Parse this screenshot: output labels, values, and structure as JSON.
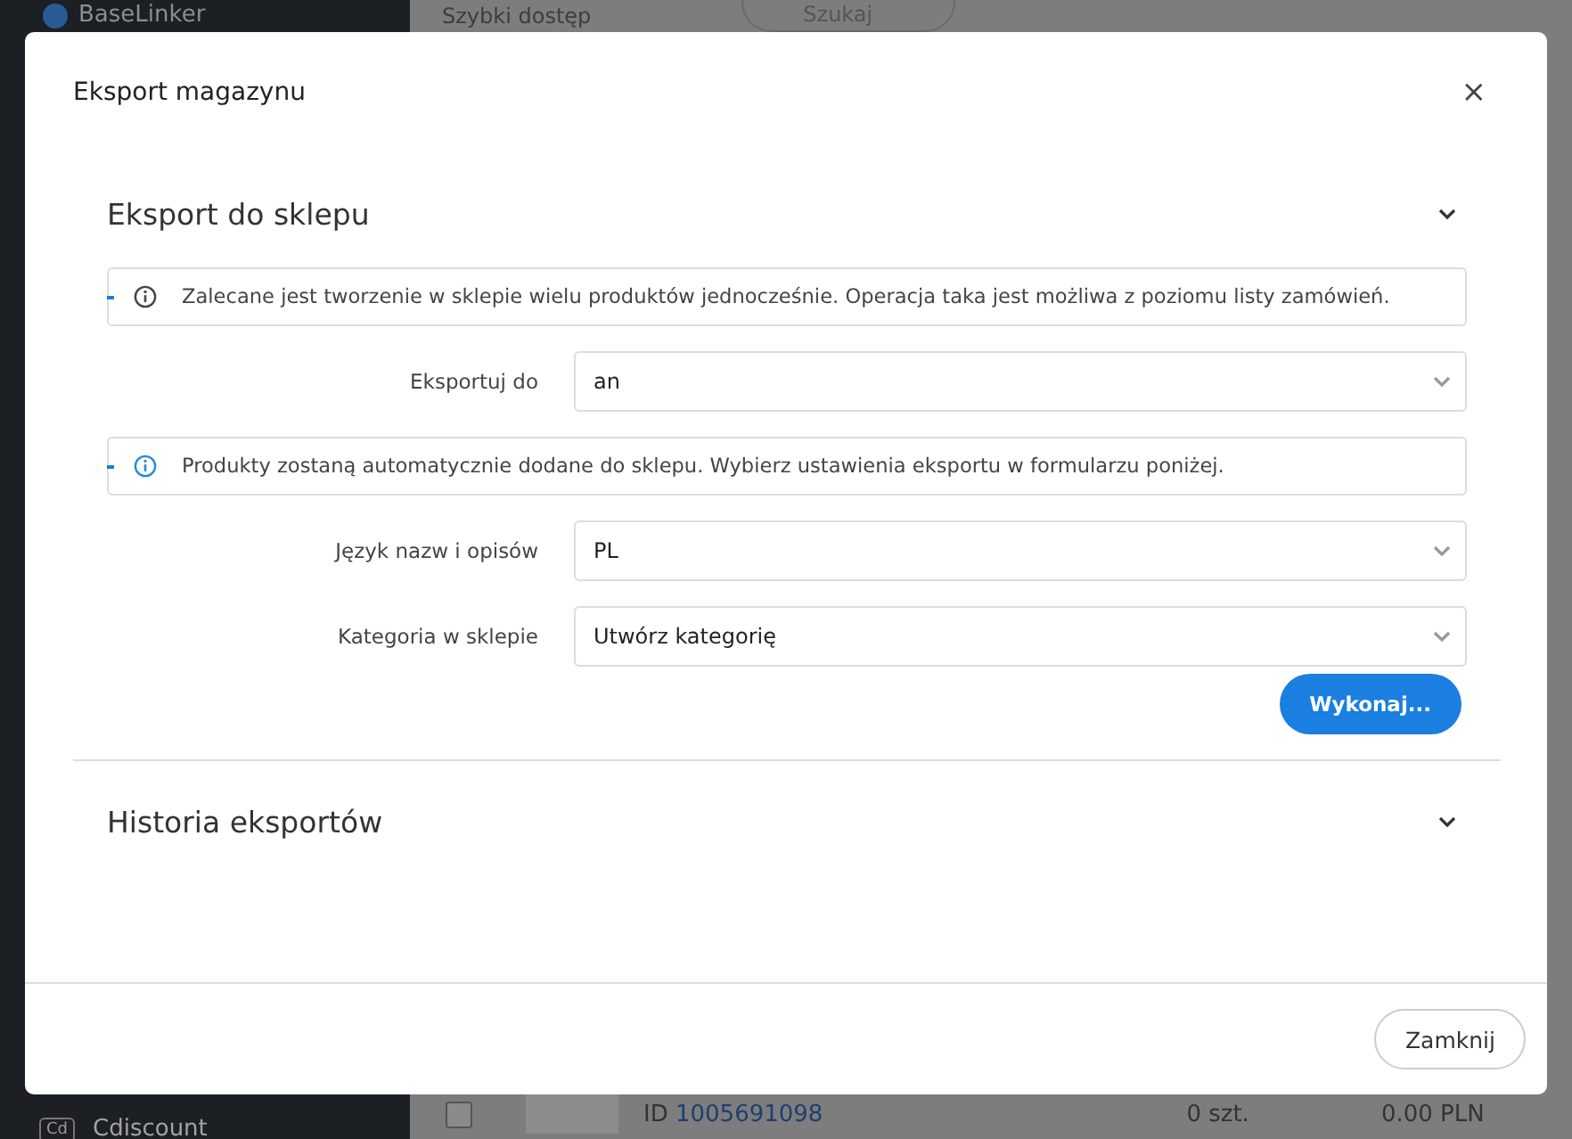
{
  "background": {
    "logo": "BaseLinker",
    "quick_access": "Szybki dostęp",
    "search_placeholder": "Szukaj",
    "row_checked": false,
    "product_id_label": "ID",
    "product_id": "1005691098",
    "quantity": "0 szt.",
    "price": "0.00 PLN",
    "sidebar_item_badge": "Cd",
    "sidebar_item": "Cdiscount"
  },
  "modal": {
    "title": "Eksport magazynu",
    "close": "×",
    "sections": [
      {
        "title": "Eksport do sklepu",
        "expanded": true,
        "items": [
          {
            "kind": "notice",
            "text": "Zalecane jest tworzenie w sklepie wielu produktów jednocześnie. Operacja taka jest możliwa z poziomu listy zamówień."
          },
          {
            "kind": "select",
            "label": "Eksportuj do",
            "value": "an"
          },
          {
            "kind": "notice",
            "text": "Produkty zostaną automatycznie dodane do sklepu. Wybierz ustawienia eksportu w formularzu poniżej."
          },
          {
            "kind": "select",
            "label": "Język nazw i opisów",
            "value": "PL"
          },
          {
            "kind": "select",
            "label": "Kategoria w sklepie",
            "value": "Utwórz kategorię"
          }
        ],
        "action": "Wykonaj..."
      },
      {
        "title": "Historia eksportów",
        "expanded": false
      }
    ],
    "footer_button": "Zamknij"
  }
}
